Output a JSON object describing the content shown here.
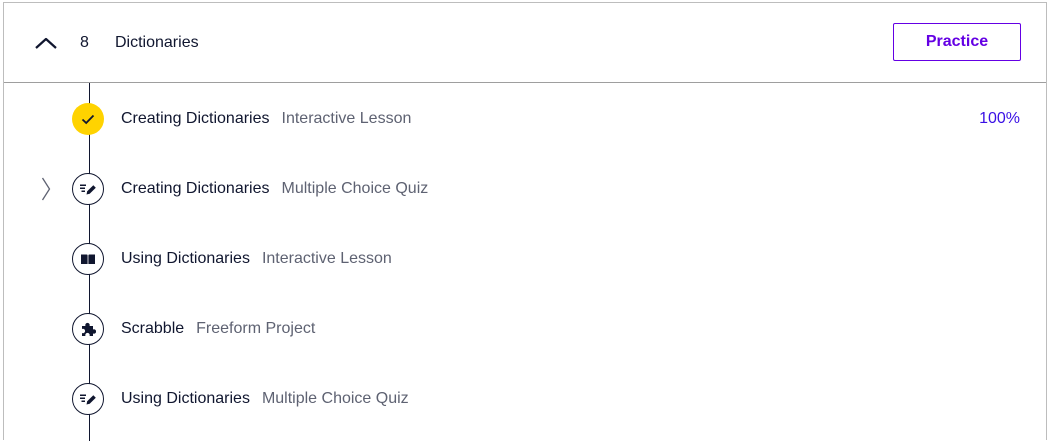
{
  "module": {
    "number": "8",
    "title": "Dictionaries",
    "practice_label": "Practice",
    "collapse_icon": "chevron-up-icon"
  },
  "items": [
    {
      "name": "Creating Dictionaries",
      "kind": "Interactive Lesson",
      "status": "completed",
      "icon": "checkmark-icon",
      "progress": "100%"
    },
    {
      "name": "Creating Dictionaries",
      "kind": "Multiple Choice Quiz",
      "status": "not-started",
      "icon": "quiz-pencil-icon",
      "expand_icon": "chevron-right-icon"
    },
    {
      "name": "Using Dictionaries",
      "kind": "Interactive Lesson",
      "status": "not-started",
      "icon": "book-icon"
    },
    {
      "name": "Scrabble",
      "kind": "Freeform Project",
      "status": "not-started",
      "icon": "puzzle-icon"
    },
    {
      "name": "Using Dictionaries",
      "kind": "Multiple Choice Quiz",
      "status": "not-started",
      "icon": "quiz-pencil-icon"
    }
  ],
  "colors": {
    "completed": "#ffd300",
    "accent": "#6400e4",
    "progress_text": "#3a10e5",
    "text": "#10162f",
    "muted": "#5e6272"
  }
}
